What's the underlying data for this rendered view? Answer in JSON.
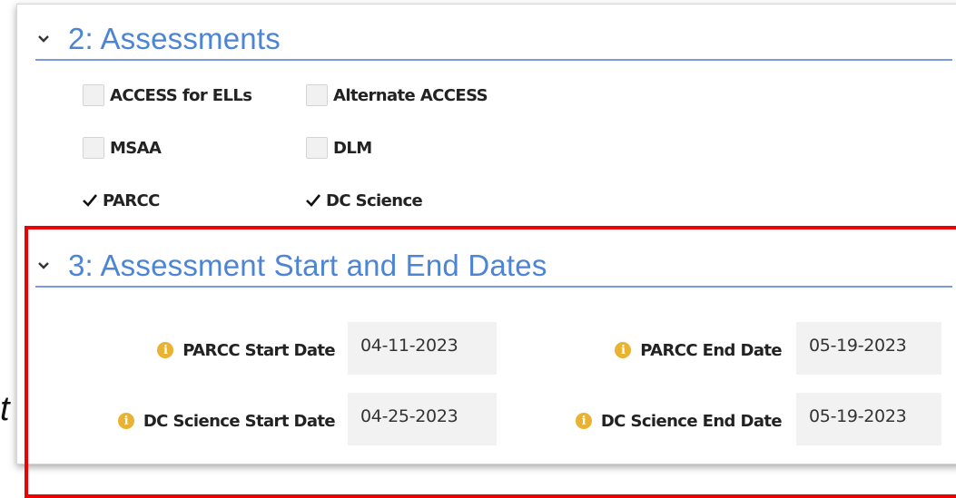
{
  "sections": {
    "assessments": {
      "title": "2: Assessments",
      "checkboxes": [
        {
          "label": "ACCESS for ELLs",
          "checked": false
        },
        {
          "label": "Alternate ACCESS",
          "checked": false
        },
        {
          "label": "MSAA",
          "checked": false
        },
        {
          "label": "DLM",
          "checked": false
        },
        {
          "label": "PARCC",
          "checked": true
        },
        {
          "label": "DC Science",
          "checked": true
        }
      ]
    },
    "dates": {
      "title": "3: Assessment Start and End Dates",
      "fields": [
        {
          "label": "PARCC Start Date",
          "value": "04-11-2023"
        },
        {
          "label": "PARCC End Date",
          "value": "05-19-2023"
        },
        {
          "label": "DC Science Start Date",
          "value": "04-25-2023"
        },
        {
          "label": "DC Science End Date",
          "value": "05-19-2023"
        }
      ]
    }
  },
  "background_fragment": "t",
  "icons": {
    "section_toggle": "chevron-down-icon",
    "field_info": "info-icon",
    "checked": "checkmark-icon"
  },
  "colors": {
    "section_title": "#4c84d6",
    "section_rule": "#7a9ad8",
    "info_icon": "#e9b233",
    "highlight": "#ee0000",
    "field_bg": "#f2f2f2"
  }
}
